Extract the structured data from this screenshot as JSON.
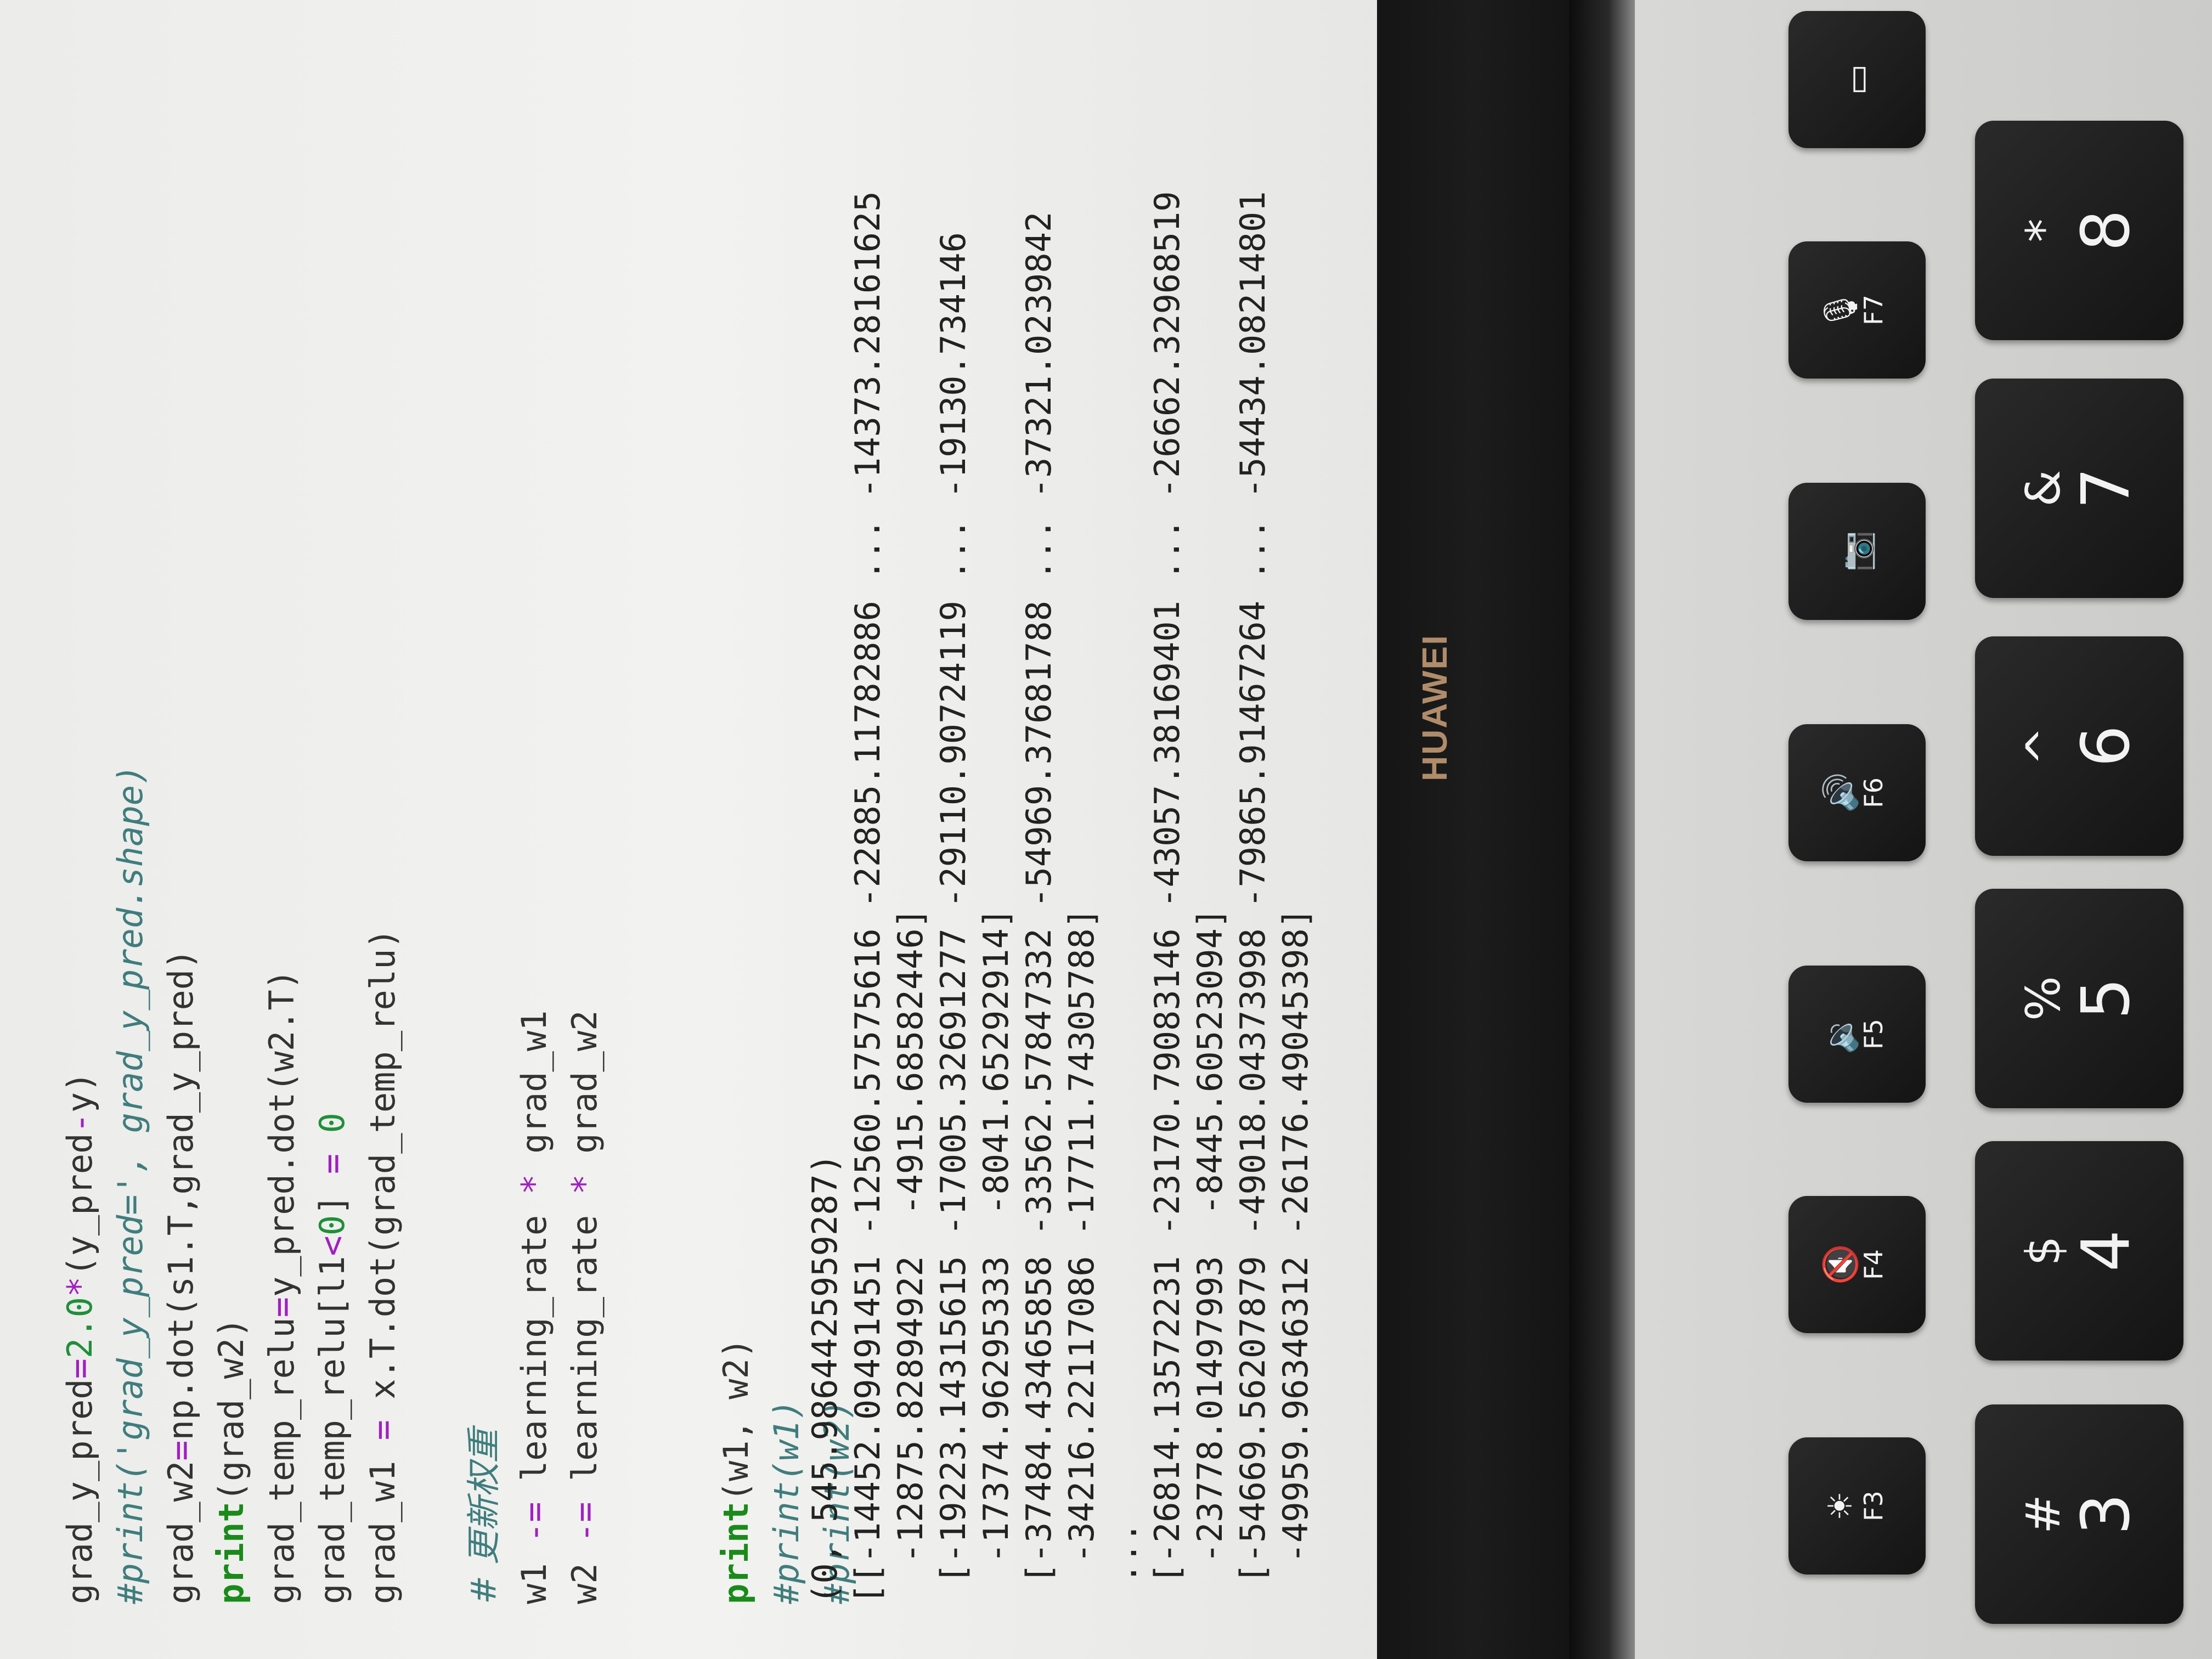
{
  "code": {
    "lines": [
      {
        "segments": [
          {
            "t": "grad_y_pred",
            "c": ""
          },
          {
            "t": "=",
            "c": "op"
          },
          {
            "t": "2.0",
            "c": "num"
          },
          {
            "t": "*",
            "c": "op"
          },
          {
            "t": "(y_pred",
            "c": ""
          },
          {
            "t": "-",
            "c": "op"
          },
          {
            "t": "y)",
            "c": ""
          }
        ]
      },
      {
        "segments": [
          {
            "t": "#print('grad_y_pred=', grad_y_pred.shape)",
            "c": "comment"
          }
        ]
      },
      {
        "segments": [
          {
            "t": "grad_w2",
            "c": ""
          },
          {
            "t": "=",
            "c": "op"
          },
          {
            "t": "np.dot(s1.T,grad_y_pred)",
            "c": ""
          }
        ]
      },
      {
        "segments": [
          {
            "t": "print",
            "c": "kw"
          },
          {
            "t": "(grad_w2)",
            "c": ""
          }
        ]
      },
      {
        "segments": [
          {
            "t": "grad_temp_relu",
            "c": ""
          },
          {
            "t": "=",
            "c": "op"
          },
          {
            "t": "y_pred.dot(w2.T)",
            "c": ""
          }
        ]
      },
      {
        "segments": [
          {
            "t": "grad_temp_relu[l1",
            "c": ""
          },
          {
            "t": "<",
            "c": "op"
          },
          {
            "t": "0",
            "c": "num"
          },
          {
            "t": "] ",
            "c": ""
          },
          {
            "t": "=",
            "c": "op"
          },
          {
            "t": " ",
            "c": ""
          },
          {
            "t": "0",
            "c": "num"
          }
        ]
      },
      {
        "segments": [
          {
            "t": "grad_w1 ",
            "c": ""
          },
          {
            "t": "=",
            "c": "op"
          },
          {
            "t": " x.T.dot(grad_temp_relu)",
            "c": ""
          }
        ]
      },
      {
        "segments": []
      },
      {
        "segments": [
          {
            "t": "# 更新权重",
            "c": "comment-cjk"
          }
        ]
      },
      {
        "segments": [
          {
            "t": "w1 ",
            "c": ""
          },
          {
            "t": "-=",
            "c": "op"
          },
          {
            "t": " learning_rate ",
            "c": ""
          },
          {
            "t": "*",
            "c": "op"
          },
          {
            "t": " grad_w1",
            "c": ""
          }
        ]
      },
      {
        "segments": [
          {
            "t": "w2 ",
            "c": ""
          },
          {
            "t": "-=",
            "c": "op"
          },
          {
            "t": " learning_rate ",
            "c": ""
          },
          {
            "t": "*",
            "c": "op"
          },
          {
            "t": " grad_w2",
            "c": ""
          }
        ]
      },
      {
        "segments": []
      },
      {
        "segments": []
      },
      {
        "segments": [
          {
            "t": "print",
            "c": "kw"
          },
          {
            "t": "(w1, w2)",
            "c": ""
          }
        ]
      },
      {
        "segments": [
          {
            "t": "#print(w1)",
            "c": "comment"
          }
        ]
      },
      {
        "segments": [
          {
            "t": "#print(w2)",
            "c": "comment"
          }
        ]
      }
    ]
  },
  "output": {
    "lines": [
      "(0, 545.9864425959287)",
      "[[-14452.09491451 -12560.57575616 -22885.11782886 ... -14373.28161625",
      "  -12875.82894922  -4915.68582446]",
      " [-19223.14315615 -17005.32691277 -29110.90724119 ... -19130.734146",
      "  -17374.96295333  -8041.65292914]",
      " [-37484.43465858 -33562.57847332 -54969.37681788 ... -37321.0239842",
      "  -34216.22117086 -17711.74305788]",
      " ...",
      " [-26814.13572231 -23170.79083146 -43057.38169401 ... -26662.32968519",
      "  -23778.01497993  -8445.60523094]",
      " [-54669.56207879 -49018.04373998 -79865.91467264 ... -54434.08214801",
      "  -49959.96346312 -26176.49045398]"
    ]
  },
  "bezel": {
    "brand": "HUAWEI"
  },
  "keyboard": {
    "function_row": [
      {
        "name": "f3",
        "label": "F3",
        "icon": "brightness-icon",
        "glyph": "☀"
      },
      {
        "name": "f4",
        "label": "F4",
        "icon": "mute-icon",
        "glyph": "🔇"
      },
      {
        "name": "f5",
        "label": "F5",
        "icon": "volume-down-icon",
        "glyph": "🔉"
      },
      {
        "name": "f6",
        "label": "F6",
        "icon": "volume-up-icon",
        "glyph": "🔊"
      },
      {
        "name": "camera",
        "label": "",
        "icon": "camera-icon",
        "glyph": "📷"
      },
      {
        "name": "f7",
        "label": "F7",
        "icon": "mic-mute-icon",
        "glyph": "🎙"
      },
      {
        "name": "display",
        "label": "",
        "icon": "display-icon",
        "glyph": "▭"
      }
    ],
    "number_row": [
      {
        "name": "3",
        "sym": "#",
        "digit": "3"
      },
      {
        "name": "4",
        "sym": "$",
        "digit": "4"
      },
      {
        "name": "5",
        "sym": "%",
        "digit": "5"
      },
      {
        "name": "6",
        "sym": "^",
        "digit": "6"
      },
      {
        "name": "7",
        "sym": "&",
        "digit": "7"
      },
      {
        "name": "8",
        "sym": "*",
        "digit": "8"
      }
    ]
  }
}
